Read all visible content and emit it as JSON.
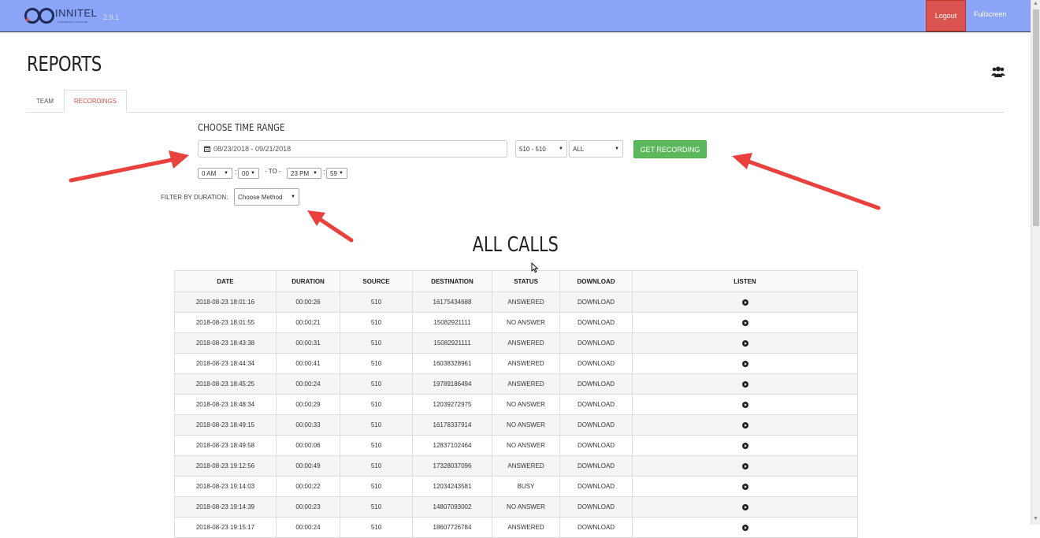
{
  "header": {
    "logo_text": "INNITEL",
    "logo_subtext": "innovative telecom",
    "version": "2.9.1",
    "logout_label": "Logout",
    "fullscreen_label": "Fullscreen",
    "bar_color": "#8aa4f7",
    "logout_color": "#d9534f"
  },
  "page": {
    "title": "REPORTS",
    "team_icon": "users-icon"
  },
  "tabs": [
    {
      "label": "TEAM",
      "active": false
    },
    {
      "label": "RECORDINGS",
      "active": true
    }
  ],
  "filters": {
    "section_label": "CHOOSE TIME RANGE",
    "date_range": "08/23/2018 - 09/21/2018",
    "extension": "510 - 510",
    "scope": "ALL",
    "get_button": "GET RECORDING",
    "from_hour": "0 AM",
    "from_minute": "00",
    "to_label": "- TO -",
    "to_hour": "23 PM",
    "to_minute": "59",
    "time_sep": ":",
    "duration_label": "FILTER BY DURATION:",
    "duration_method": "Choose Method"
  },
  "calls": {
    "title": "ALL CALLS",
    "columns": [
      "DATE",
      "DURATION",
      "SOURCE",
      "DESTINATION",
      "STATUS",
      "DOWNLOAD",
      "LISTEN"
    ],
    "rows": [
      {
        "date": "2018-08-23 18:01:16",
        "duration": "00:00:26",
        "source": "510",
        "destination": "16175434688",
        "status": "ANSWERED",
        "download": "DOWNLOAD"
      },
      {
        "date": "2018-08-23 18:01:55",
        "duration": "00:00:21",
        "source": "510",
        "destination": "15082921111",
        "status": "NO ANSWER",
        "download": "DOWNLOAD"
      },
      {
        "date": "2018-08-23 18:43:38",
        "duration": "00:00:31",
        "source": "510",
        "destination": "15082921111",
        "status": "ANSWERED",
        "download": "DOWNLOAD"
      },
      {
        "date": "2018-08-23 18:44:34",
        "duration": "00:00:41",
        "source": "510",
        "destination": "16038328961",
        "status": "ANSWERED",
        "download": "DOWNLOAD"
      },
      {
        "date": "2018-08-23 18:45:25",
        "duration": "00:00:24",
        "source": "510",
        "destination": "19789186494",
        "status": "ANSWERED",
        "download": "DOWNLOAD"
      },
      {
        "date": "2018-08-23 18:48:34",
        "duration": "00:00:29",
        "source": "510",
        "destination": "12039272975",
        "status": "NO ANSWER",
        "download": "DOWNLOAD"
      },
      {
        "date": "2018-08-23 18:49:15",
        "duration": "00:00:33",
        "source": "510",
        "destination": "16178337914",
        "status": "NO ANSWER",
        "download": "DOWNLOAD"
      },
      {
        "date": "2018-08-23 18:49:58",
        "duration": "00:00:06",
        "source": "510",
        "destination": "12837102464",
        "status": "NO ANSWER",
        "download": "DOWNLOAD"
      },
      {
        "date": "2018-08-23 19:12:56",
        "duration": "00:00:49",
        "source": "510",
        "destination": "17328037096",
        "status": "ANSWERED",
        "download": "DOWNLOAD"
      },
      {
        "date": "2018-08-23 19:14:03",
        "duration": "00:00:22",
        "source": "510",
        "destination": "12034243581",
        "status": "BUSY",
        "download": "DOWNLOAD"
      },
      {
        "date": "2018-08-23 19:14:39",
        "duration": "00:00:23",
        "source": "510",
        "destination": "14807093002",
        "status": "NO ANSWER",
        "download": "DOWNLOAD"
      },
      {
        "date": "2018-08-23 19:15:17",
        "duration": "00:00:24",
        "source": "510",
        "destination": "18607726784",
        "status": "ANSWERED",
        "download": "DOWNLOAD"
      }
    ]
  },
  "annotations": {
    "arrow_color": "#e8413e"
  }
}
